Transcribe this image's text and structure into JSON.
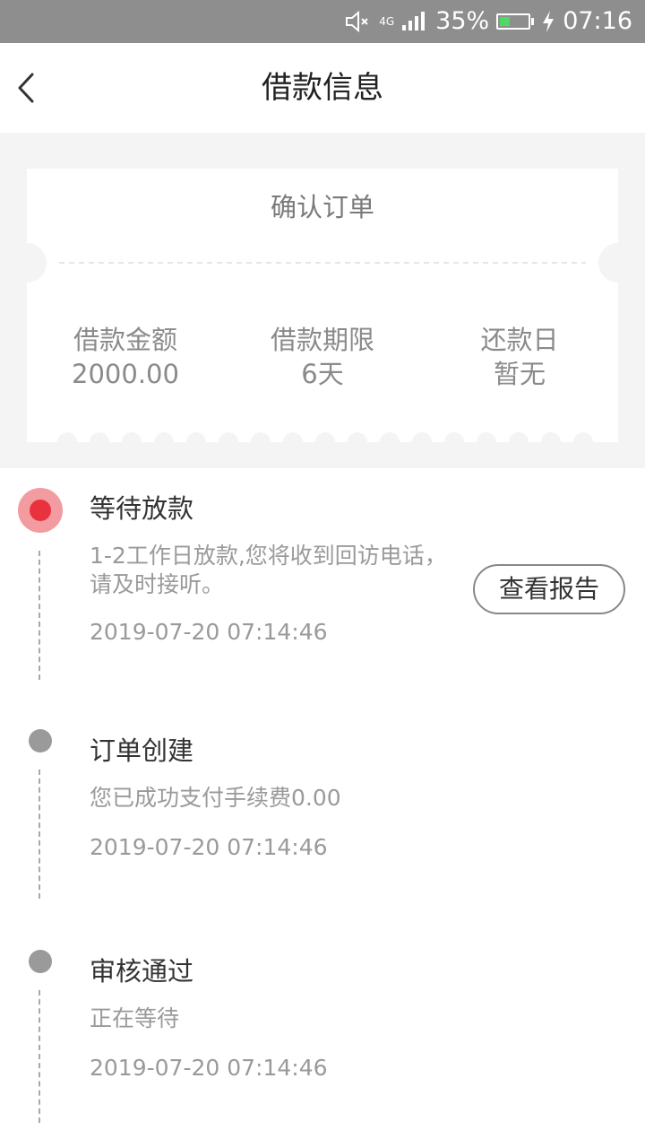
{
  "status_bar": {
    "battery_percent": "35%",
    "battery_level": 0.35,
    "time": "07:16",
    "network_label": "4G",
    "icons": [
      "mute-icon",
      "signal-icon",
      "battery-icon",
      "charging-icon"
    ]
  },
  "header": {
    "title": "借款信息",
    "back_icon": "chevron-left-icon"
  },
  "ticket": {
    "title": "确认订单",
    "items": [
      {
        "label": "借款金额",
        "value": "2000.00"
      },
      {
        "label": "借款期限",
        "value": "6天"
      },
      {
        "label": "还款日",
        "value": "暂无"
      }
    ]
  },
  "timeline": {
    "items": [
      {
        "title": "等待放款",
        "desc": "1-2工作日放款,您将收到回访电话，请及时接听。",
        "time": "2019-07-20 07:14:46",
        "status": "active",
        "button_label": "查看报告"
      },
      {
        "title": "订单创建",
        "desc": "您已成功支付手续费0.00",
        "time": "2019-07-20 07:14:46",
        "status": "done"
      },
      {
        "title": "审核通过",
        "desc": "正在等待",
        "time": "2019-07-20 07:14:46",
        "status": "done"
      }
    ]
  },
  "colors": {
    "accent_red": "#e8323e",
    "accent_red_light": "#f29ba0",
    "status_bar_bg": "#8e8e8e",
    "page_bg": "#f4f4f4",
    "dot_gray": "#9a9a9a"
  }
}
